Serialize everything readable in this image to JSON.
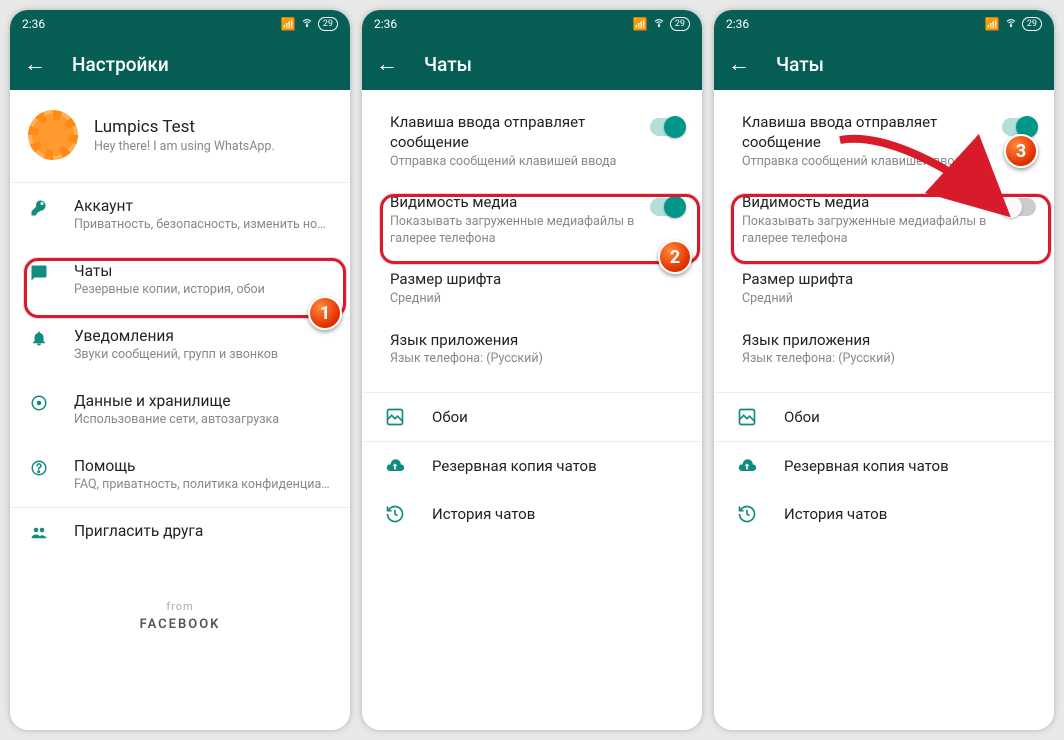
{
  "status": {
    "time": "2:36",
    "battery": "29"
  },
  "screen1": {
    "title": "Настройки",
    "profile": {
      "name": "Lumpics Test",
      "status": "Hey there! I am using WhatsApp."
    },
    "items": [
      {
        "title": "Аккаунт",
        "sub": "Приватность, безопасность, изменить номер"
      },
      {
        "title": "Чаты",
        "sub": "Резервные копии, история, обои"
      },
      {
        "title": "Уведомления",
        "sub": "Звуки сообщений, групп и звонков"
      },
      {
        "title": "Данные и хранилище",
        "sub": "Использование сети, автозагрузка"
      },
      {
        "title": "Помощь",
        "sub": "FAQ, приватность, политика конфиденциальн..."
      },
      {
        "title": "Пригласить друга",
        "sub": ""
      }
    ],
    "footer_from": "from",
    "footer_brand": "FACEBOOK"
  },
  "screen2": {
    "title": "Чаты",
    "enter_send": {
      "title": "Клавиша ввода отправляет сообщение",
      "sub": "Отправка сообщений клавишей ввода"
    },
    "media_vis": {
      "title": "Видимость медиа",
      "sub": "Показывать загруженные медиафайлы в галерее телефона"
    },
    "font_size": {
      "title": "Размер шрифта",
      "sub": "Средний"
    },
    "app_lang": {
      "title": "Язык приложения",
      "sub": "Язык телефона: (Русский)"
    },
    "wallpaper": "Обои",
    "backup": "Резервная копия чатов",
    "history": "История чатов"
  },
  "screen3": {
    "title": "Чаты"
  },
  "steps": {
    "s1": "1",
    "s2": "2",
    "s3": "3"
  }
}
